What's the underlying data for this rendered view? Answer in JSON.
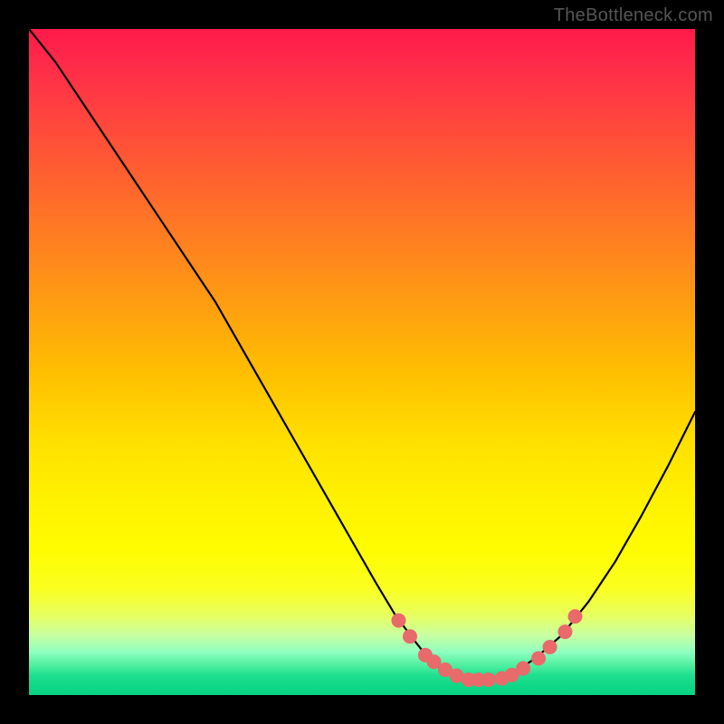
{
  "watermark": "TheBottleneck.com",
  "chart_data": {
    "type": "line",
    "title": "",
    "xlabel": "",
    "ylabel": "",
    "xlim": [
      0,
      100
    ],
    "ylim": [
      0,
      100
    ],
    "curve": {
      "name": "bottleneck-curve",
      "x": [
        0,
        4,
        8,
        12,
        16,
        20,
        24,
        28,
        32,
        36,
        40,
        44,
        48,
        52,
        55,
        58,
        60,
        62,
        64,
        66,
        68,
        70,
        73,
        76,
        80,
        84,
        88,
        92,
        96,
        100
      ],
      "y": [
        100,
        95,
        89,
        83,
        77,
        71,
        65,
        59,
        52,
        45,
        38,
        31,
        24,
        17,
        12,
        8,
        5.5,
        3.8,
        2.8,
        2.3,
        2.3,
        2.6,
        3.5,
        5.5,
        9,
        14,
        20,
        27,
        34.5,
        42.5
      ]
    },
    "dots": {
      "name": "highlight-points",
      "color": "#e86a6a",
      "radius": 8,
      "x": [
        55.5,
        57.2,
        59.5,
        60.8,
        62.5,
        64.2,
        66.0,
        67.5,
        69.0,
        71.0,
        72.5,
        74.2,
        76.5,
        78.2,
        80.5,
        82.0
      ],
      "y": [
        11.2,
        8.8,
        6.0,
        5.0,
        3.8,
        2.9,
        2.3,
        2.3,
        2.3,
        2.5,
        3.0,
        4.0,
        5.5,
        7.2,
        9.5,
        11.8
      ]
    },
    "gradient_stops": [
      {
        "pct": 0,
        "color": "#ff1a4a"
      },
      {
        "pct": 12,
        "color": "#ff4040"
      },
      {
        "pct": 32,
        "color": "#ff8020"
      },
      {
        "pct": 52,
        "color": "#ffc000"
      },
      {
        "pct": 78,
        "color": "#fffc00"
      },
      {
        "pct": 93.5,
        "color": "#90ffc0"
      },
      {
        "pct": 100,
        "color": "#08d484"
      }
    ]
  }
}
